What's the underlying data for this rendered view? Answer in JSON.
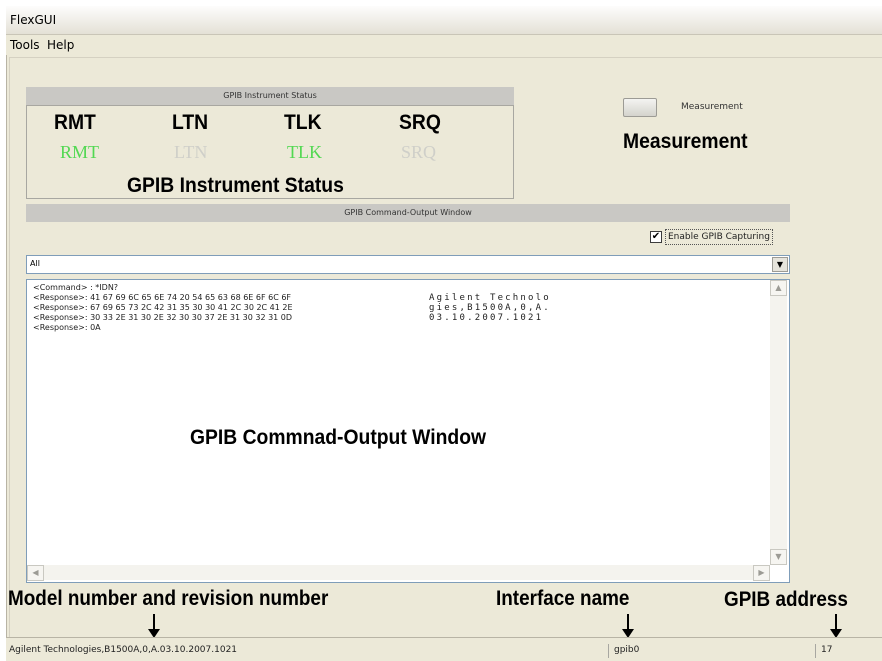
{
  "window": {
    "title": "FlexGUI"
  },
  "menu": {
    "tools": "Tools",
    "help": "Help"
  },
  "gpib_status": {
    "header": "GPIB Instrument Status",
    "indicators": [
      {
        "label": "RMT",
        "state": "on"
      },
      {
        "label": "LTN",
        "state": "off"
      },
      {
        "label": "TLK",
        "state": "on"
      },
      {
        "label": "SRQ",
        "state": "off"
      }
    ],
    "annotation_labels": [
      "RMT",
      "LTN",
      "TLK",
      "SRQ"
    ],
    "annotation_title": "GPIB Instrument Status"
  },
  "measurement": {
    "label": "Measurement",
    "annotation": "Measurement"
  },
  "command_window": {
    "header": "GPIB Command-Output Window",
    "enable_capture_label": "Enable GPIB Capturing",
    "enable_capture_checked": true,
    "filter_value": "All",
    "lines": [
      {
        "text": "<Command> : *IDN?",
        "ascii": ""
      },
      {
        "text": "<Response>: 41 67 69 6C 65 6E 74 20 54 65 63 68 6E 6F 6C 6F",
        "ascii": "Agilent Technolo"
      },
      {
        "text": "<Response>: 67 69 65 73 2C 42 31 35 30 30 41 2C 30 2C 41 2E",
        "ascii": "gies,B1500A,0,A."
      },
      {
        "text": "<Response>: 30 33 2E 31 30 2E 32 30 30 37 2E 31 30 32 31 0D",
        "ascii": "03.10.2007.1021"
      },
      {
        "text": "<Response>: 0A",
        "ascii": ""
      }
    ],
    "annotation": "GPIB Commnad-Output Window"
  },
  "annotations": {
    "model": "Model number and revision number",
    "interface": "Interface name",
    "address": "GPIB address"
  },
  "statusbar": {
    "model": "Agilent Technologies,B1500A,0,A.03.10.2007.1021",
    "interface": "gpib0",
    "address": "17"
  },
  "colors": {
    "indicator_on": "#52d852",
    "indicator_off": "#cfcfc9",
    "window_bg": "#ece9d8"
  }
}
